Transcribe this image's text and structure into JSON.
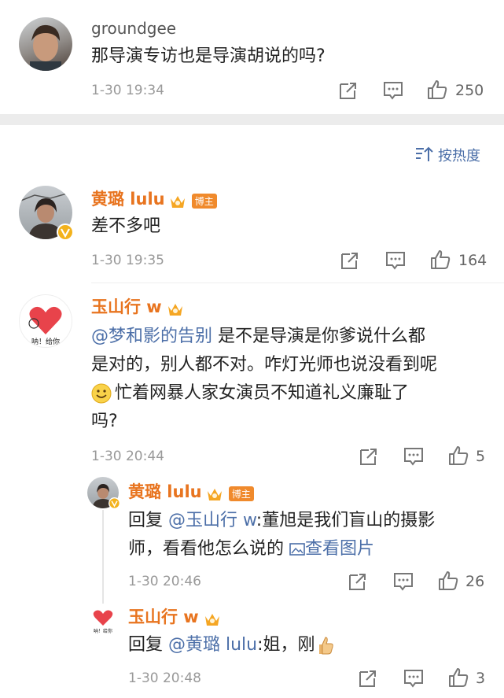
{
  "comments": [
    {
      "name": "groundgee",
      "text": "那导演专访也是导演胡说的吗?",
      "time": "1-30 19:34",
      "likes": "250"
    },
    {
      "name": "黄璐 lulu",
      "badge": "博主",
      "text": "差不多吧",
      "time": "1-30 19:35",
      "likes": "164"
    },
    {
      "name": "玉山行 w",
      "avatar_text": "呐！给你",
      "mention": "@梦和影的告别",
      "text_line1": " 是不是导演是你爹说什么都",
      "text_line2": "是对的，别人都不对。咋灯光师也说没看到呢",
      "text_line3": "忙着网暴人家女演员不知道礼义廉耻了",
      "text_line4": "吗?",
      "time": "1-30 20:44",
      "likes": "5"
    }
  ],
  "replies": [
    {
      "name": "黄璐 lulu",
      "badge": "博主",
      "prefix": "回复 ",
      "mention": "@玉山行 w",
      "text_line1": ":董旭是我们盲山的摄影",
      "text_line2": "师，看看他怎么说的 ",
      "link": "查看图片",
      "time": "1-30 20:46",
      "likes": "26"
    },
    {
      "name": "玉山行 w",
      "avatar_text": "呐！给你",
      "prefix": "回复 ",
      "mention": "@黄璐 lulu",
      "text": ":姐，刚",
      "time": "1-30 20:48",
      "likes": "3"
    }
  ],
  "sort": {
    "label": "按热度"
  }
}
